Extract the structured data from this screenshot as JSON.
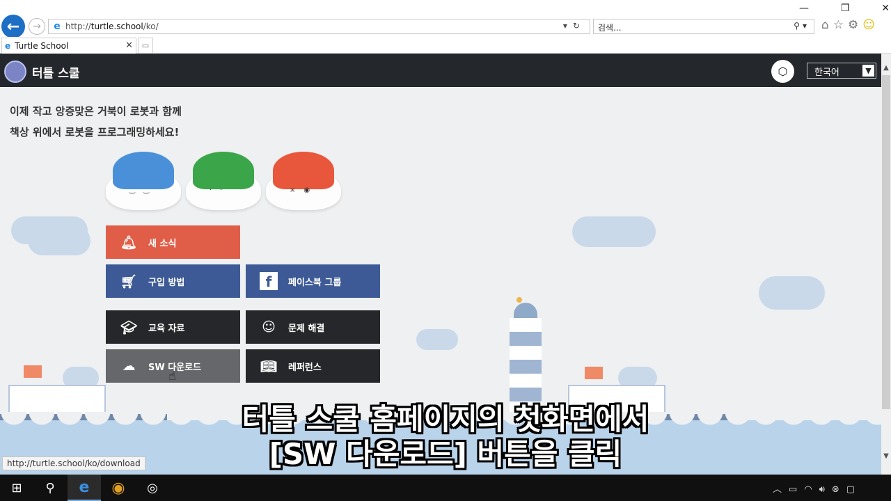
{
  "browser": {
    "url_prefix": "http://",
    "url_domain": "turtle.school",
    "url_path": "/ko/",
    "search_placeholder": "검색...",
    "tab_title": "Turtle School",
    "status_url": "http://turtle.school/ko/download"
  },
  "site": {
    "logo_text": "터틀 스쿨",
    "language": "한국어",
    "headline_line1": "이제 작고 앙증맞은 거북이 로봇과 함께",
    "headline_line2": "책상 위에서 로봇을 프로그래밍하세요!",
    "buttons": {
      "news": "새 소식",
      "purchase": "구입 방법",
      "facebook": "페이스북 그룹",
      "education": "교육 자료",
      "troubleshoot": "문제 해결",
      "sw_download": "SW 다운로드",
      "reference": "레퍼런스"
    }
  },
  "subtitle": {
    "line1": "터틀 스쿨 홈페이지의 첫화면에서",
    "line2": "[SW 다운로드] 버튼을 클릭"
  },
  "colors": {
    "header_bg": "#24272b",
    "news_btn": "#e05e48",
    "social_btn": "#3d5a96",
    "dark_btn": "#25272b",
    "sw_btn": "#65676b",
    "turtle_blue": "#4a90d9",
    "turtle_green": "#3aa649",
    "turtle_red": "#e8573c"
  }
}
